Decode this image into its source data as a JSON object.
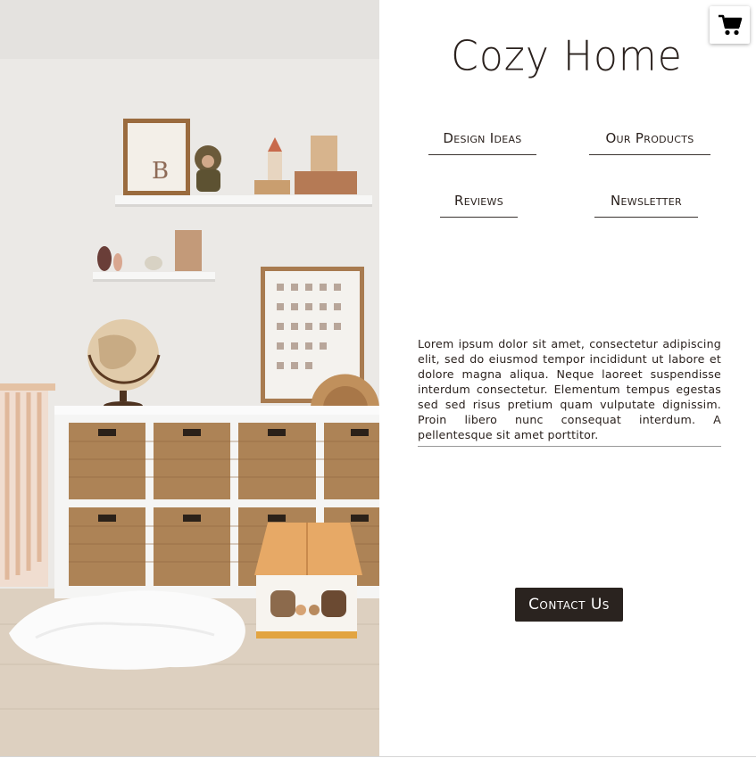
{
  "brand": {
    "title": "Cozy Home"
  },
  "header": {
    "cart_icon": "shopping-cart-icon"
  },
  "nav": {
    "items": [
      {
        "label": "Design Ideas"
      },
      {
        "label": "Our Products"
      },
      {
        "label": "Reviews"
      },
      {
        "label": "Newsletter"
      }
    ]
  },
  "content": {
    "paragraph": "Lorem ipsum dolor sit amet, consectetur adipiscing elit, sed do eiusmod tempor incididunt ut labore et dolore magna aliqua. Neque laoreet suspendisse interdum consectetur. Elementum tempus egestas sed sed risus pretium quam vulputate dignissim. Proin libero nunc consequat interdum. A pellentesque sit amet porttitor."
  },
  "cta": {
    "label": "Contact Us"
  },
  "colors": {
    "accent_dark": "#2a231f",
    "background": "#ffffff"
  }
}
